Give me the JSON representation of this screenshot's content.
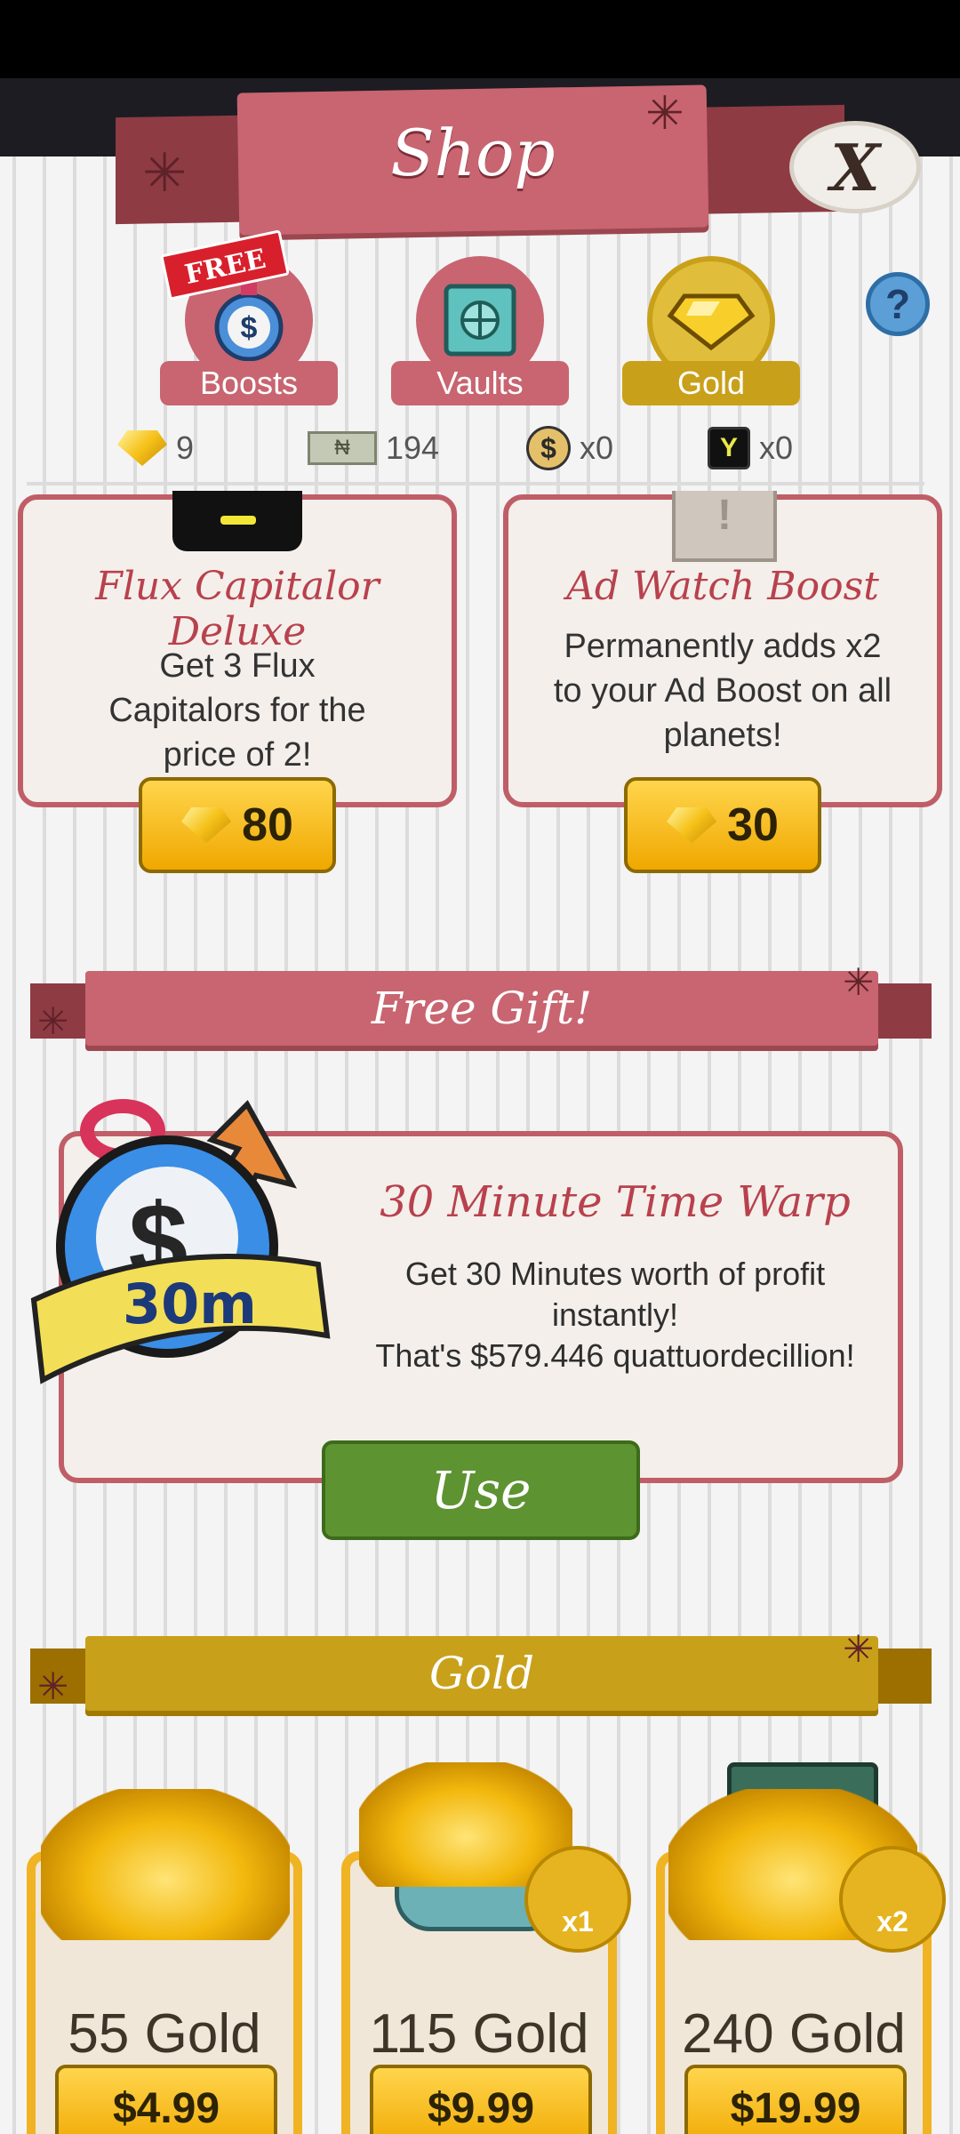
{
  "header": {
    "title": "Shop",
    "close_label": "X"
  },
  "tabs": [
    {
      "label": "Boosts",
      "badge": "FREE",
      "color": "#c86570"
    },
    {
      "label": "Vaults",
      "color": "#c86570"
    },
    {
      "label": "Gold",
      "color": "#c9a01a"
    }
  ],
  "help_label": "?",
  "currencies": [
    {
      "icon": "gold-bar-icon",
      "value": "9"
    },
    {
      "icon": "megabuck-icon",
      "value": "194"
    },
    {
      "icon": "money-bag-icon",
      "value": "x0"
    },
    {
      "icon": "flux-capitalor-icon",
      "value": "x0"
    }
  ],
  "offers": [
    {
      "title": "Flux Capitalor Deluxe",
      "description": "Get 3 Flux Capitalors for the price of 2!",
      "price": "80"
    },
    {
      "title": "Ad Watch Boost",
      "description": "Permanently adds x2 to your Ad Boost on all planets!",
      "price": "30"
    }
  ],
  "free_gift": {
    "section_title": "Free Gift!",
    "badge_text": "30m",
    "title": "30 Minute Time Warp",
    "line1": "Get 30 Minutes worth of profit instantly!",
    "line2": "That's $579.446 quattuordecillion!",
    "button": "Use"
  },
  "gold_section": {
    "title": "Gold",
    "packs": [
      {
        "name": "55 Gold",
        "price": "$4.99",
        "multiplier": ""
      },
      {
        "name": "115 Gold",
        "price": "$9.99",
        "multiplier": "x1"
      },
      {
        "name": "240 Gold",
        "price": "$19.99",
        "multiplier": "x2"
      }
    ]
  },
  "colors": {
    "rose": "#c86570",
    "gold": "#c9a01a",
    "green": "#5e9331"
  }
}
